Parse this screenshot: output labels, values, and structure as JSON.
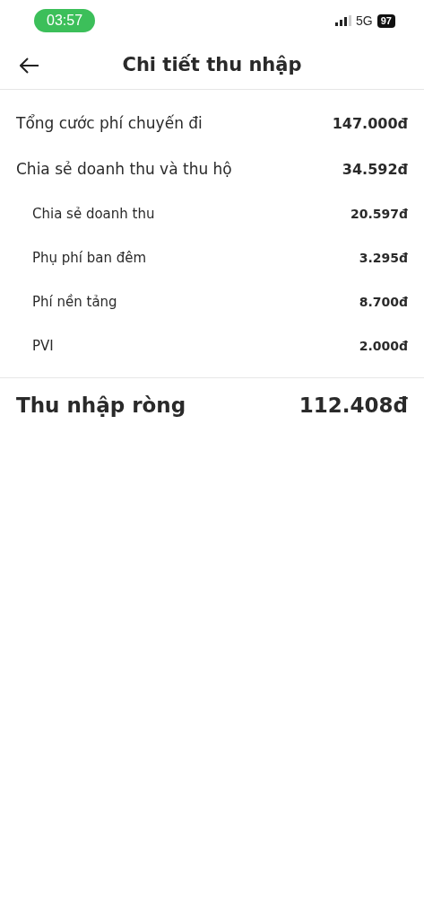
{
  "status_bar": {
    "time": "03:57",
    "network": "5G",
    "battery": "97"
  },
  "header": {
    "title": "Chi tiết thu nhập"
  },
  "items": [
    {
      "label": "Tổng cước phí chuyến đi",
      "amount": "147.000đ"
    },
    {
      "label": "Chia sẻ doanh thu và thu hộ",
      "amount": "34.592đ",
      "children": [
        {
          "label": "Chia sẻ doanh thu",
          "amount": "20.597đ"
        },
        {
          "label": "Phụ phí ban đêm",
          "amount": "3.295đ"
        },
        {
          "label": "Phí nền tảng",
          "amount": "8.700đ"
        },
        {
          "label": "PVI",
          "amount": "2.000đ"
        }
      ]
    }
  ],
  "total": {
    "label": "Thu nhập ròng",
    "amount": "112.408đ"
  }
}
